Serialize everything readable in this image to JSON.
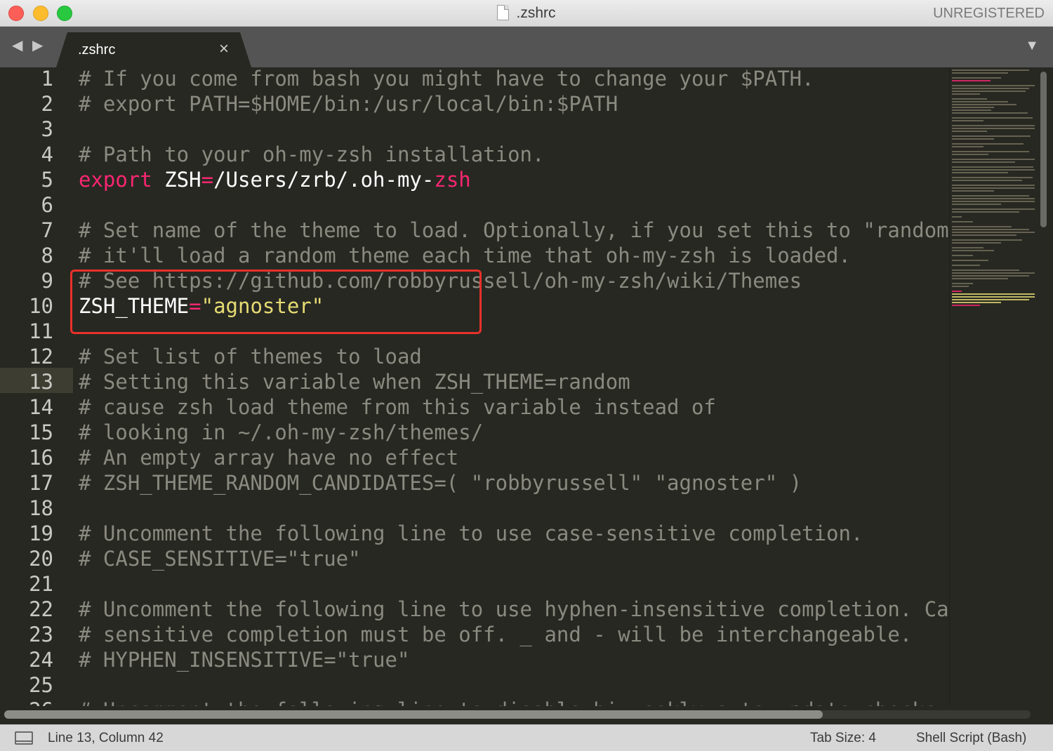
{
  "window": {
    "title": ".zshrc",
    "license_status": "UNREGISTERED"
  },
  "tabbar": {
    "nav_arrows": "◀ ▶",
    "tab_label": ".zshrc",
    "tab_close": "×",
    "dropdown": "▼"
  },
  "editor": {
    "current_line": 13,
    "line_numbers": [
      "1",
      "2",
      "3",
      "4",
      "5",
      "6",
      "7",
      "8",
      "9",
      "10",
      "11",
      "12",
      "13",
      "14",
      "15",
      "16",
      "17",
      "18",
      "19",
      "20",
      "21",
      "22",
      "23",
      "24",
      "25",
      "26"
    ],
    "lines": {
      "l1": "# If you come from bash you might have to change your $PATH.",
      "l2": "# export PATH=$HOME/bin:/usr/local/bin:$PATH",
      "l4": "# Path to your oh-my-zsh installation.",
      "l5_kw": "export",
      "l5_var": " ZSH",
      "l5_eq": "=",
      "l5_path": "/Users/zrb/.oh-my-",
      "l5_zsh": "zsh",
      "l7": "# Set name of the theme to load. Optionally, if you set this to \"random\"",
      "l8": "# it'll load a random theme each time that oh-my-zsh is loaded.",
      "l9": "# See https://github.com/robbyrussell/oh-my-zsh/wiki/Themes",
      "l10_var": "ZSH_THEME",
      "l10_eq": "=",
      "l10_val": "\"agnoster\"",
      "l12": "# Set list of themes to load",
      "l13": "# Setting this variable when ZSH_THEME=random",
      "l14": "# cause zsh load theme from this variable instead of",
      "l15": "# looking in ~/.oh-my-zsh/themes/",
      "l16": "# An empty array have no effect",
      "l17": "# ZSH_THEME_RANDOM_CANDIDATES=( \"robbyrussell\" \"agnoster\" )",
      "l19": "# Uncomment the following line to use case-sensitive completion.",
      "l20": "# CASE_SENSITIVE=\"true\"",
      "l22": "# Uncomment the following line to use hyphen-insensitive completion. Case",
      "l23": "# sensitive completion must be off. _ and - will be interchangeable.",
      "l24": "# HYPHEN_INSENSITIVE=\"true\"",
      "l26": "# Uncomment the following line to disable bi-weekly auto-update checks."
    }
  },
  "statusbar": {
    "position": "Line 13, Column 42",
    "tab_size": "Tab Size: 4",
    "syntax": "Shell Script (Bash)"
  },
  "colors": {
    "background": "#272822",
    "comment": "#8a8a80",
    "keyword": "#f92672",
    "string": "#e6db74",
    "highlight_box": "#e8312a"
  }
}
